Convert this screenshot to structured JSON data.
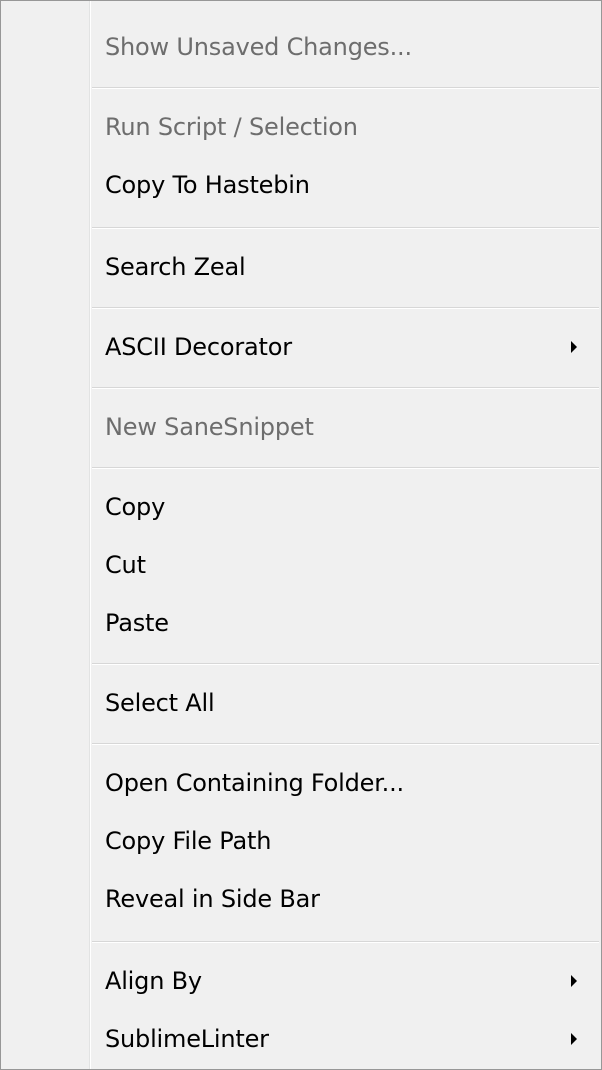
{
  "menu": {
    "items": [
      {
        "label": "Show Unsaved Changes...",
        "disabled": true,
        "submenu": false
      },
      {
        "label": "Run Script / Selection",
        "disabled": true,
        "submenu": false
      },
      {
        "label": "Copy To Hastebin",
        "disabled": false,
        "submenu": false
      },
      {
        "label": "Search Zeal",
        "disabled": false,
        "submenu": false
      },
      {
        "label": "ASCII Decorator",
        "disabled": false,
        "submenu": true
      },
      {
        "label": "New SaneSnippet",
        "disabled": true,
        "submenu": false
      },
      {
        "label": "Copy",
        "disabled": false,
        "submenu": false
      },
      {
        "label": "Cut",
        "disabled": false,
        "submenu": false
      },
      {
        "label": "Paste",
        "disabled": false,
        "submenu": false
      },
      {
        "label": "Select All",
        "disabled": false,
        "submenu": false
      },
      {
        "label": "Open Containing Folder...",
        "disabled": false,
        "submenu": false
      },
      {
        "label": "Copy File Path",
        "disabled": false,
        "submenu": false
      },
      {
        "label": "Reveal in Side Bar",
        "disabled": false,
        "submenu": false
      },
      {
        "label": "Align By",
        "disabled": false,
        "submenu": true
      },
      {
        "label": "SublimeLinter",
        "disabled": false,
        "submenu": true
      }
    ],
    "submenu_icon": "submenu-arrow-icon"
  }
}
